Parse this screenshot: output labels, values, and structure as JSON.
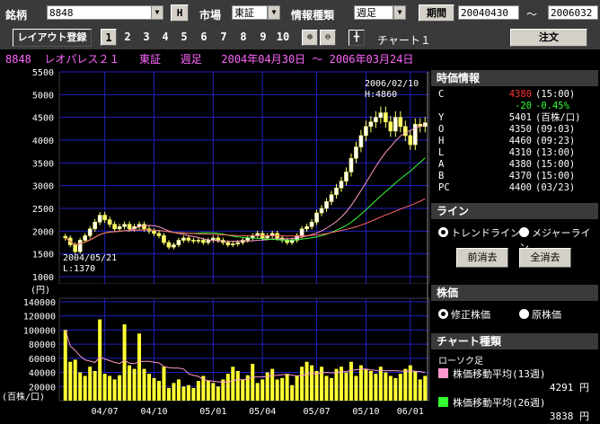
{
  "toolbar": {
    "stock_label": "銘柄",
    "stock_code": "8848",
    "h_button": "H",
    "market_label": "市場",
    "market_value": "東証",
    "info_type_label": "情報種類",
    "info_type_value": "週足",
    "period_button": "期間",
    "date_from": "20040430",
    "date_sep": "〜",
    "date_to": "2006032"
  },
  "toolbar2": {
    "layout_button": "レイアウト登録",
    "slots": [
      "1",
      "2",
      "3",
      "4",
      "5",
      "6",
      "7",
      "8",
      "9",
      "10"
    ],
    "selected_slot": "1",
    "chart_label": "チャート１",
    "order_button": "注文"
  },
  "infobar": "8848  レオパレス２１   東証   週足   2004年04月30日 〜 2006年03月24日",
  "quote": {
    "header": "時価情報",
    "rows": [
      {
        "k": "C",
        "v": "4380",
        "t": "(15:00)",
        "color": "#ff3030"
      },
      {
        "k": "",
        "v": "-20",
        "t": "-0.45%",
        "color": "#33ff33"
      },
      {
        "k": "Y",
        "v": "5401",
        "t": "(百株/口)",
        "color": "#ffffff"
      },
      {
        "k": "O",
        "v": "4350",
        "t": "(09:03)",
        "color": "#ffffff"
      },
      {
        "k": "H",
        "v": "4460",
        "t": "(09:23)",
        "color": "#ffffff"
      },
      {
        "k": "L",
        "v": "4310",
        "t": "(13:00)",
        "color": "#ffffff"
      },
      {
        "k": "A",
        "v": "4380",
        "t": "(15:00)",
        "color": "#ffffff"
      },
      {
        "k": "B",
        "v": "4370",
        "t": "(15:00)",
        "color": "#ffffff"
      },
      {
        "k": "PC",
        "v": "4400",
        "t": "(03/23)",
        "color": "#ffffff"
      }
    ]
  },
  "line_panel": {
    "header": "ライン",
    "radio1": "トレンドライン",
    "radio2": "メジャーライン",
    "btn1": "前消去",
    "btn2": "全消去"
  },
  "price_panel": {
    "header": "株価",
    "radio1": "修正株価",
    "radio2": "原株価"
  },
  "chart_type_panel": {
    "header": "チャート種類",
    "sub": "ローソク足",
    "ma1_label": "株価移動平均(13週)",
    "ma1_value": "4291 円",
    "ma1_color": "#ff99cc",
    "ma2_label": "株価移動平均(26週)",
    "ma2_value": "3838 円",
    "ma2_color": "#33ff33"
  },
  "chart_data": {
    "type": "candlestick",
    "unit_price": "(円)",
    "unit_volume": "(百株/口)",
    "price_ticks": [
      "5500",
      "5000",
      "4500",
      "4000",
      "3500",
      "3000",
      "2500",
      "2000",
      "1500",
      "1000"
    ],
    "price_ylim": [
      1000,
      5500
    ],
    "volume_ticks": [
      "140000",
      "120000",
      "100000",
      "80000",
      "60000",
      "40000",
      "20000"
    ],
    "volume_ylim": [
      0,
      145000
    ],
    "x_ticks": [
      "04/07",
      "04/10",
      "05/01",
      "05/04",
      "05/07",
      "05/10",
      "06/01"
    ],
    "annotation_high": "2006/02/10",
    "annotation_high_value": "H:4860",
    "annotation_low": "2004/05/21",
    "annotation_low_value": "L:1370",
    "close": [
      1850,
      1700,
      1550,
      1800,
      1900,
      2050,
      2200,
      2350,
      2250,
      2150,
      2050,
      2100,
      2150,
      2050,
      2100,
      2150,
      2050,
      2000,
      1950,
      1900,
      1750,
      1650,
      1700,
      1800,
      1850,
      1800,
      1780,
      1800,
      1750,
      1800,
      1850,
      1800,
      1750,
      1700,
      1720,
      1750,
      1800,
      1850,
      1900,
      1950,
      1850,
      1900,
      1950,
      1850,
      1800,
      1750,
      1800,
      1900,
      2050,
      2100,
      2200,
      2400,
      2500,
      2650,
      2800,
      2950,
      3100,
      3300,
      3600,
      3850,
      4100,
      4300,
      4400,
      4500,
      4600,
      4400,
      4200,
      4500,
      4300,
      4100,
      3900,
      4350,
      4300,
      4380
    ],
    "volume": [
      100000,
      55000,
      58000,
      40000,
      35000,
      48000,
      42000,
      115000,
      38000,
      35000,
      30000,
      36000,
      108000,
      50000,
      45000,
      95000,
      45000,
      38000,
      32000,
      28000,
      48000,
      18000,
      25000,
      30000,
      20000,
      22000,
      18000,
      28000,
      35000,
      28000,
      25000,
      20000,
      30000,
      38000,
      48000,
      42000,
      30000,
      36000,
      52000,
      25000,
      30000,
      40000,
      45000,
      30000,
      32000,
      38000,
      22000,
      35000,
      48000,
      55000,
      50000,
      42000,
      48000,
      35000,
      32000,
      45000,
      48000,
      40000,
      55000,
      35000,
      50000,
      45000,
      42000,
      38000,
      48000,
      40000,
      35000,
      32000,
      38000,
      45000,
      50000,
      42000,
      30000,
      35000
    ]
  }
}
